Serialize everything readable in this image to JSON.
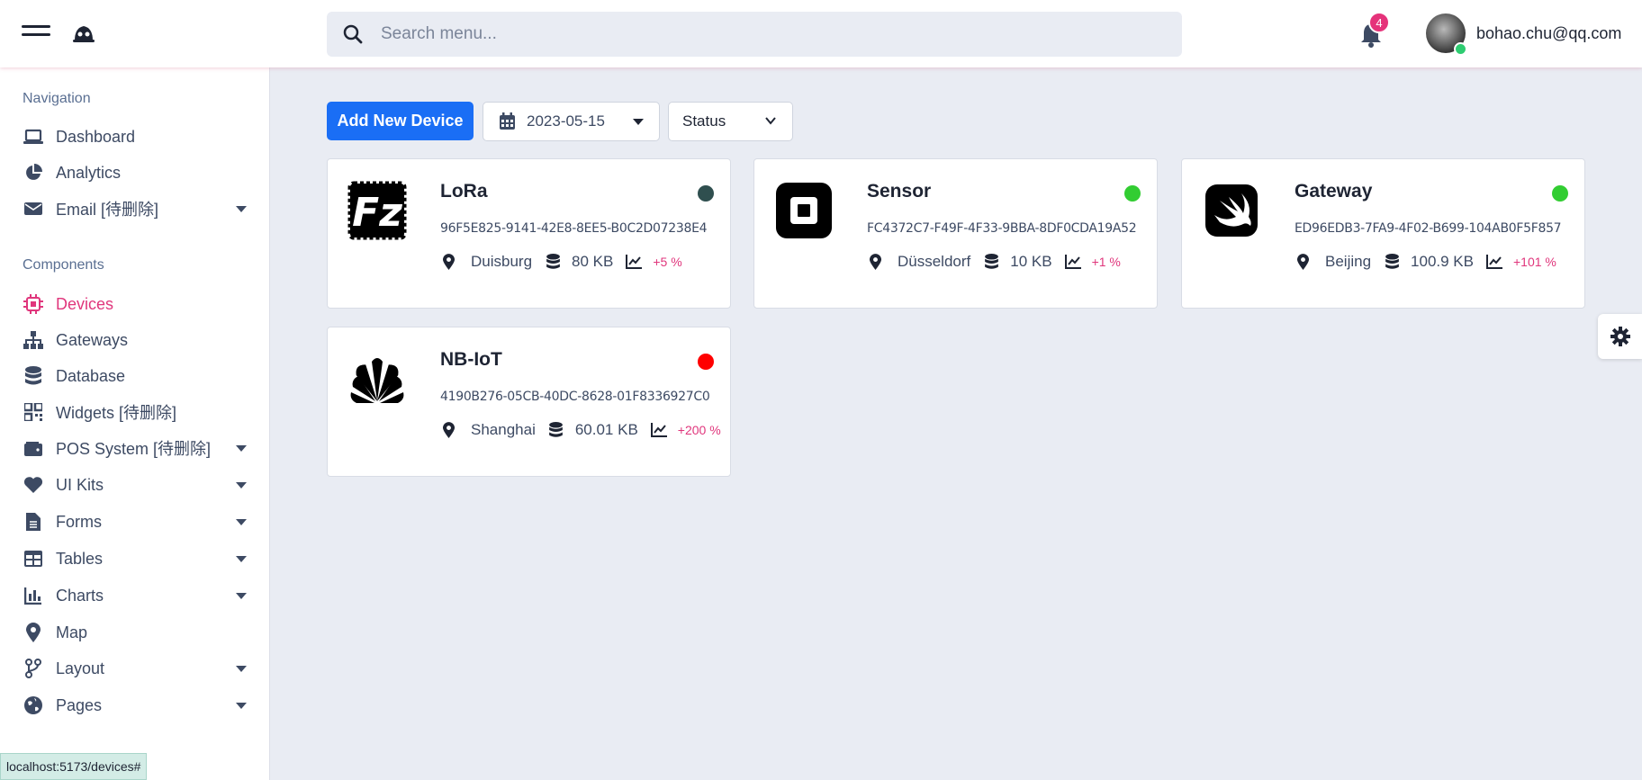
{
  "header": {
    "search_placeholder": "Search menu...",
    "notification_count": "4",
    "user_email": "bohao.chu@qq.com"
  },
  "sidebar": {
    "sections": [
      {
        "title": "Navigation",
        "items": [
          {
            "label": "Dashboard",
            "icon": "laptop-icon",
            "has_submenu": false
          },
          {
            "label": "Analytics",
            "icon": "pie-chart-icon",
            "has_submenu": false
          },
          {
            "label": "Email [待删除]",
            "icon": "envelope-icon",
            "has_submenu": true
          }
        ]
      },
      {
        "title": "Components",
        "items": [
          {
            "label": "Devices",
            "icon": "chip-icon",
            "has_submenu": false,
            "active": true
          },
          {
            "label": "Gateways",
            "icon": "sitemap-icon",
            "has_submenu": false
          },
          {
            "label": "Database",
            "icon": "database-icon",
            "has_submenu": false
          },
          {
            "label": "Widgets [待删除]",
            "icon": "qrcode-icon",
            "has_submenu": false
          },
          {
            "label": "POS System [待删除]",
            "icon": "wallet-icon",
            "has_submenu": true
          },
          {
            "label": "UI Kits",
            "icon": "heart-icon",
            "has_submenu": true
          },
          {
            "label": "Forms",
            "icon": "file-icon",
            "has_submenu": true
          },
          {
            "label": "Tables",
            "icon": "table-icon",
            "has_submenu": true
          },
          {
            "label": "Charts",
            "icon": "line-chart-icon",
            "has_submenu": true
          },
          {
            "label": "Map",
            "icon": "map-marker-icon",
            "has_submenu": false
          },
          {
            "label": "Layout",
            "icon": "code-branch-icon",
            "has_submenu": true
          },
          {
            "label": "Pages",
            "icon": "globe-icon",
            "has_submenu": true
          }
        ]
      }
    ]
  },
  "toolbar": {
    "add_button_label": "Add New Device",
    "date_value": "2023-05-15",
    "status_label": "Status"
  },
  "devices": [
    {
      "name": "LoRa",
      "uuid": "96F5E825-9141-42E8-8EE5-B0C2D07238E4",
      "city": "Duisburg",
      "size": "80 KB",
      "trend": "+5 %",
      "status_color": "#2f4f4f",
      "logo": "filezilla-logo-icon"
    },
    {
      "name": "Sensor",
      "uuid": "FC4372C7-F49F-4F33-9BBA-8DF0CDA19A52",
      "city": "Düsseldorf",
      "size": "10 KB",
      "trend": "+1 %",
      "status_color": "#32cd32",
      "logo": "square-logo-icon"
    },
    {
      "name": "Gateway",
      "uuid": "ED96EDB3-7FA9-4F02-B699-104AB0F5F857",
      "city": "Beijing",
      "size": "100.9 KB",
      "trend": "+101 %",
      "status_color": "#32cd32",
      "logo": "swift-logo-icon"
    },
    {
      "name": "NB-IoT",
      "uuid": "4190B276-05CB-40DC-8628-01F8336927C0",
      "city": "Shanghai",
      "size": "60.01 KB",
      "trend": "+200 %",
      "status_color": "#ff0000",
      "logo": "huawei-logo-icon"
    }
  ],
  "status_bar": {
    "url": "localhost:5173/devices#"
  },
  "colors": {
    "accent": "#1a6ef5",
    "active_nav": "#e0367c",
    "badge": "#e5337a"
  }
}
